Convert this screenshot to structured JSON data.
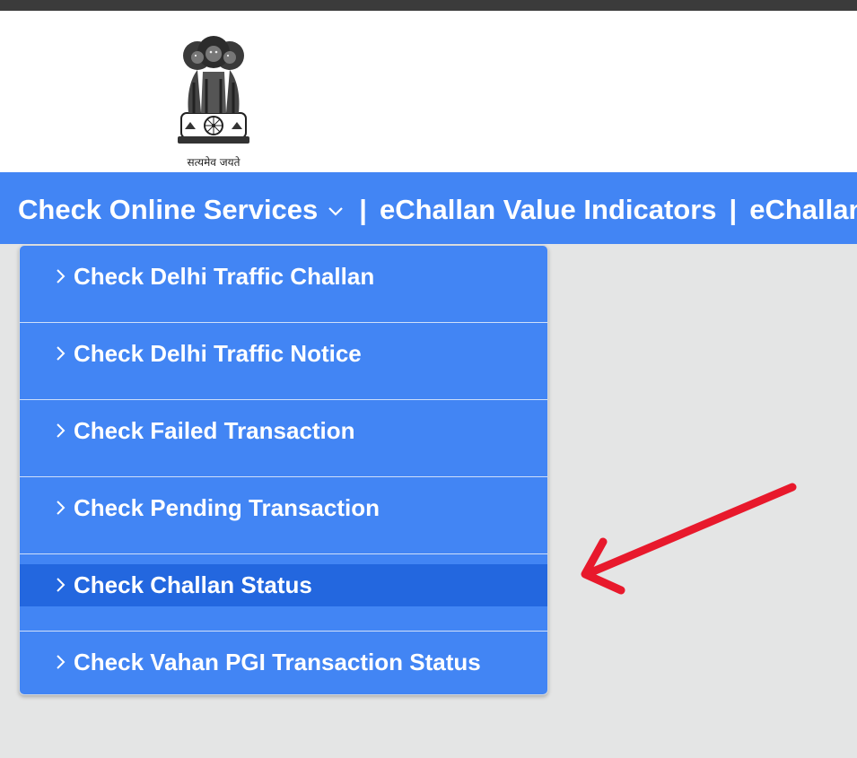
{
  "header": {
    "emblem_motto": "सत्यमेव जयते",
    "emblem_icon": "ashoka-emblem-icon"
  },
  "navbar": {
    "items": [
      {
        "label": "Check Online Services"
      },
      {
        "label": "eChallan Value Indicators"
      },
      {
        "label": "eChallan"
      }
    ],
    "separator": "|",
    "dropdown_icon": "chevron-down-icon"
  },
  "dropdown": {
    "items": [
      {
        "label": "Check Delhi Traffic Challan"
      },
      {
        "label": "Check Delhi Traffic Notice"
      },
      {
        "label": "Check Failed Transaction"
      },
      {
        "label": "Check Pending Transaction"
      },
      {
        "label": "Check Challan Status",
        "highlighted": true
      },
      {
        "label": "Check Vahan PGI Transaction Status"
      }
    ],
    "item_icon": "chevron-right-icon"
  },
  "annotation": {
    "icon": "red-arrow-icon",
    "color": "#e8192c"
  },
  "colors": {
    "navbar_bg": "#4285f4",
    "highlight_bg": "#2367df",
    "page_bg": "#e4e5e5",
    "top_strip": "#3b3b3b"
  }
}
